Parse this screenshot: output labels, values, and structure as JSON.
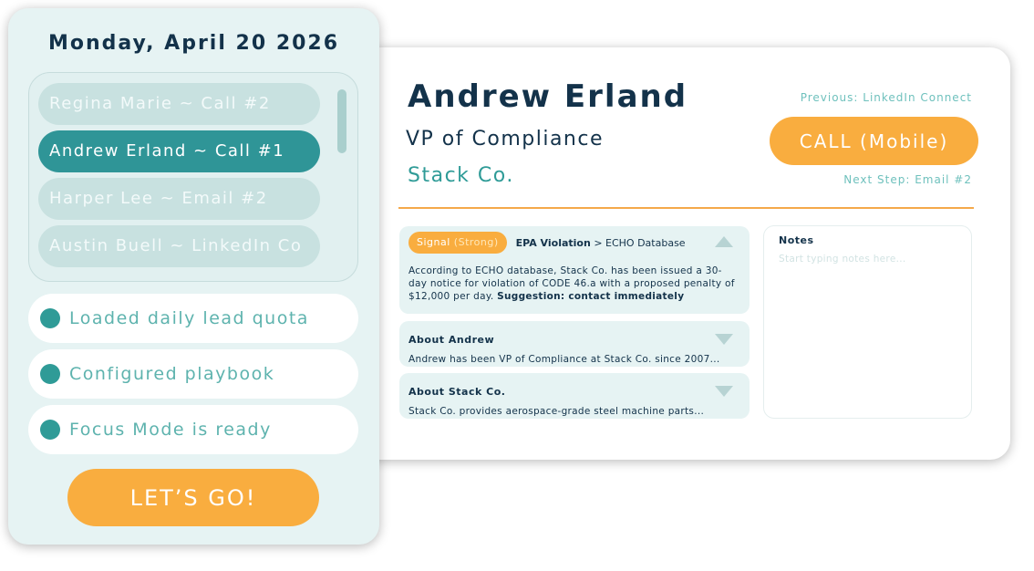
{
  "queue": {
    "date": "Monday, April 20 2026",
    "leads": [
      {
        "label": "Regina Marie ~ Call #2",
        "active": false
      },
      {
        "label": "Andrew Erland ~ Call #1",
        "active": true
      },
      {
        "label": "Harper Lee ~ Email #2",
        "active": false
      },
      {
        "label": "Austin Buell ~ LinkedIn Co",
        "active": false
      }
    ],
    "status": [
      {
        "label": "Loaded daily lead quota"
      },
      {
        "label": "Configured playbook"
      },
      {
        "label": "Focus Mode is ready"
      }
    ],
    "go_label": "LET’S GO!"
  },
  "contact": {
    "name": "Andrew Erland",
    "title": "VP of Compliance",
    "company": "Stack Co.",
    "previous_step": "Previous: LinkedIn Connect",
    "call_label": "CALL (Mobile)",
    "next_step": "Next Step: Email #2"
  },
  "signal": {
    "pill_label": "Signal",
    "strength": "(Strong)",
    "topic": "EPA Violation",
    "separator": ">",
    "source": "ECHO Database",
    "body": "According to ECHO database, Stack Co. has been issued a 30-day notice for violation of CODE 46.a with a proposed penalty of $12,000 per day.",
    "suggestion": "Suggestion: contact immediately"
  },
  "about_person": {
    "title": "About Andrew",
    "snippet": "Andrew has been VP of Compliance at Stack Co. since 2007..."
  },
  "about_company": {
    "title": "About Stack Co.",
    "snippet": "Stack Co. provides aerospace-grade steel machine parts..."
  },
  "notes": {
    "label": "Notes",
    "placeholder": "Start typing notes here..."
  },
  "colors": {
    "navy": "#13324a",
    "teal": "#2f9b97",
    "orange": "#f9ad3f",
    "panel_bg": "#e6f3f3"
  }
}
